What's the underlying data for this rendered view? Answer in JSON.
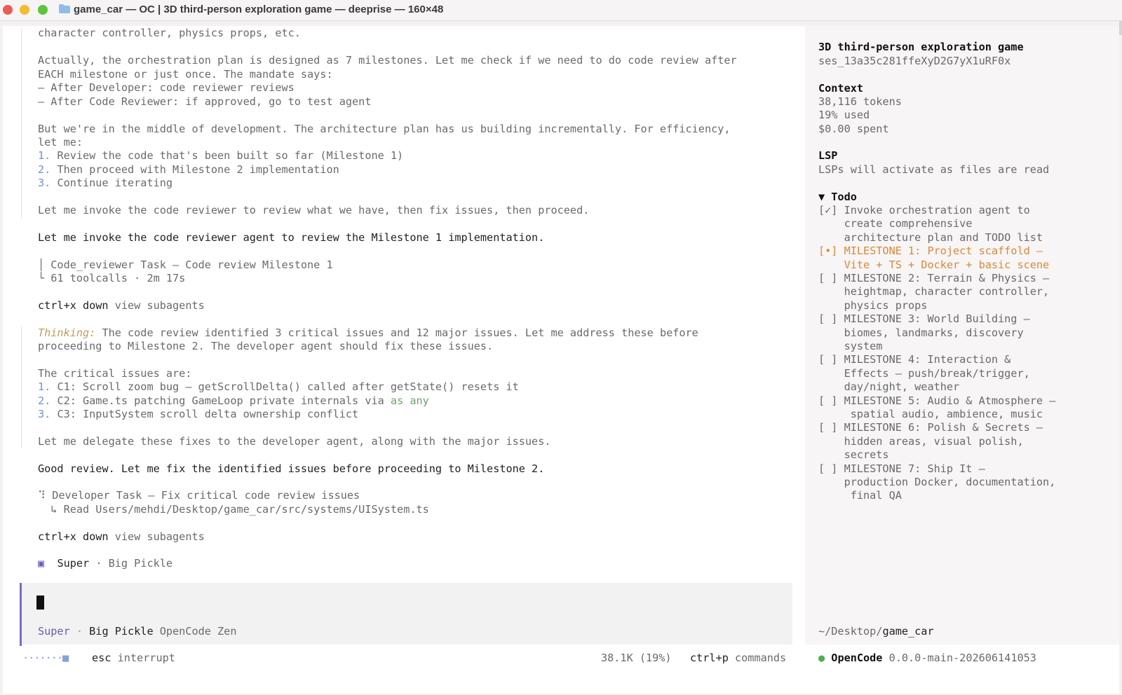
{
  "window": {
    "title": "game_car — OC | 3D third-person exploration game — deeprise — 160×48"
  },
  "transcript": {
    "l1": "character controller, physics props, etc.",
    "l2": "Actually, the orchestration plan is designed as 7 milestones. Let me check if we need to do code review after",
    "l3": "EACH milestone or just once. The mandate says:",
    "l4": "– After Developer: code reviewer reviews",
    "l5": "– After Code Reviewer: if approved, go to test agent",
    "l6": "But we're in the middle of development. The architecture plan has us building incrementally. For efficiency,",
    "l7": "let me:",
    "list1": [
      {
        "n": "1.",
        "t": " Review the code that's been built so far (Milestone 1)"
      },
      {
        "n": "2.",
        "t": " Then proceed with Milestone 2 implementation"
      },
      {
        "n": "3.",
        "t": " Continue iterating"
      }
    ],
    "l8": "Let me invoke the code reviewer to review what we have, then fix issues, then proceed.",
    "l9": "Let me invoke the code reviewer agent to review the Milestone 1 implementation.",
    "task1": "│ Code_reviewer Task — Code review Milestone 1",
    "task1_sub": "└ 61 toolcalls · 2m 17s",
    "ctrl_key": "ctrl+x down",
    "ctrl_label": " view subagents",
    "thinking_label": "Thinking:",
    "thinking_1": " The code review identified 3 critical issues and 12 major issues. Let me address these before",
    "thinking_2": "proceeding to Milestone 2. The developer agent should fix these issues.",
    "critical_head": "The critical issues are:",
    "critical": [
      {
        "n": "1.",
        "t": " C1: Scroll zoom bug — getScrollDelta() called after getState() resets it",
        "code": ""
      },
      {
        "n": "2.",
        "t": " C2: Game.ts patching GameLoop private internals via ",
        "code": "as any"
      },
      {
        "n": "3.",
        "t": " C3: InputSystem scroll delta ownership conflict",
        "code": ""
      }
    ],
    "delegate": "Let me delegate these fixes to the developer agent, along with the major issues.",
    "good_review": "Good review. Let me fix the identified issues before proceeding to Milestone 2.",
    "task2": "⠹ Developer Task — Fix critical code review issues",
    "task2_sub": "  ↳ Read Users/mehdi/Desktop/game_car/src/systems/UISystem.ts",
    "ctrl2_key": "ctrl+x down",
    "ctrl2_label": " view subagents",
    "agent_icon": "▣",
    "agent_name": "  Super",
    "agent_model": " · Big Pickle"
  },
  "prompt": {
    "mode": "Super",
    "dot": " · ",
    "model": "Big Pickle",
    "provider": " OpenCode Zen"
  },
  "statusbar": {
    "spinner": "·······■",
    "esc_key": "esc",
    "esc_label": " interrupt",
    "usage": "38.1K (19%)",
    "cmd_key": "ctrl+p",
    "cmd_label": " commands"
  },
  "sidebar": {
    "session_title": "3D third-person exploration game",
    "session_id": "ses_13a35c281ffeXyD2G7yX1uRF0x",
    "context_head": "Context",
    "tokens": "38,116 tokens",
    "used": "19% used",
    "spent": "$0.00 spent",
    "lsp_head": "LSP",
    "lsp_text": "LSPs will activate as files are read",
    "todo_head": "▼ Todo",
    "todo_lines": [
      {
        "t": "[✓] Invoke orchestration agent to",
        "s": "done"
      },
      {
        "t": "    create comprehensive",
        "s": "done"
      },
      {
        "t": "    architecture plan and TODO list",
        "s": "done"
      },
      {
        "t": "[•] MILESTONE 1: Project scaffold –",
        "s": "active"
      },
      {
        "t": "    Vite + TS + Docker + basic scene",
        "s": "active"
      },
      {
        "t": "[ ] MILESTONE 2: Terrain & Physics –",
        "s": "todo"
      },
      {
        "t": "    heightmap, character controller,",
        "s": "todo"
      },
      {
        "t": "    physics props",
        "s": "todo"
      },
      {
        "t": "[ ] MILESTONE 3: World Building –",
        "s": "todo"
      },
      {
        "t": "    biomes, landmarks, discovery",
        "s": "todo"
      },
      {
        "t": "    system",
        "s": "todo"
      },
      {
        "t": "[ ] MILESTONE 4: Interaction &",
        "s": "todo"
      },
      {
        "t": "    Effects – push/break/trigger,",
        "s": "todo"
      },
      {
        "t": "    day/night, weather",
        "s": "todo"
      },
      {
        "t": "[ ] MILESTONE 5: Audio & Atmosphere –",
        "s": "todo"
      },
      {
        "t": "     spatial audio, ambience, music",
        "s": "todo"
      },
      {
        "t": "[ ] MILESTONE 6: Polish & Secrets –",
        "s": "todo"
      },
      {
        "t": "    hidden areas, visual polish,",
        "s": "todo"
      },
      {
        "t": "    secrets",
        "s": "todo"
      },
      {
        "t": "[ ] MILESTONE 7: Ship It –",
        "s": "todo"
      },
      {
        "t": "    production Docker, documentation,",
        "s": "todo"
      },
      {
        "t": "     final QA",
        "s": "todo"
      }
    ],
    "path_prefix": "~/Desktop/",
    "path_dir": "game_car",
    "app_dot": "●",
    "app_name": " OpenCode",
    "app_version": " 0.0.0-main-202606141053"
  },
  "colors": {
    "accent": "#d9893a",
    "prompt_bar": "#7b6bc6",
    "status_dot": "#4caf50"
  }
}
